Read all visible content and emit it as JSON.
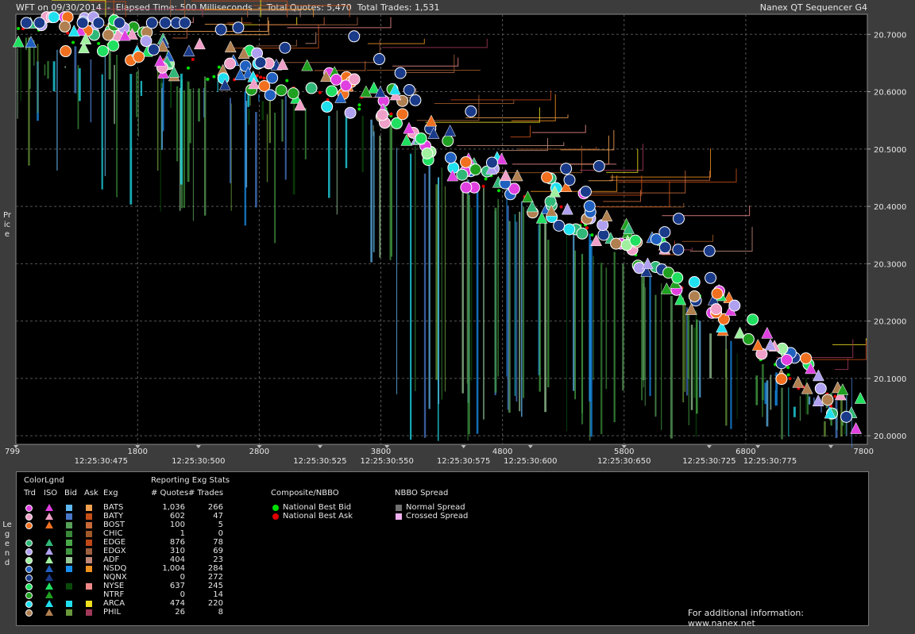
{
  "header": {
    "left": "WFT on 09/30/2014  -  Elapsed Time: 500 Milliseconds  -  Total Quotes: 5,470  Total Trades: 1,531",
    "right": "Nanex QT Sequencer G4"
  },
  "side_labels": {
    "price": "Price",
    "legend": "Legend"
  },
  "chart_data": {
    "type": "scatter",
    "x_ticks": [
      "799",
      "1800",
      "2800",
      "3800",
      "4800",
      "5800",
      "6800",
      "7800"
    ],
    "x_ticks_secondary": [
      "12:25:30:475",
      "12:25:30:500",
      "12:25:30:525",
      "12:25:30:550",
      "12:25:30:575",
      "12:25:30:600",
      "12:25:30:650",
      "12:25:30:725",
      "12:25:30:775"
    ],
    "y_ticks": [
      "20.7000",
      "20.6000",
      "20.5000",
      "20.4000",
      "20.3000",
      "20.2000",
      "20.1000",
      "20.0000"
    ],
    "xlim": [
      799,
      7800
    ],
    "ylim": [
      19.985,
      20.735
    ],
    "grid": true,
    "price_trend": [
      [
        799,
        20.71
      ],
      [
        1500,
        20.69
      ],
      [
        2300,
        20.64
      ],
      [
        3000,
        20.61
      ],
      [
        3800,
        20.57
      ],
      [
        4500,
        20.46
      ],
      [
        5300,
        20.39
      ],
      [
        6000,
        20.31
      ],
      [
        6600,
        20.2
      ],
      [
        7200,
        20.1
      ],
      [
        7800,
        20.02
      ]
    ]
  },
  "legend": {
    "color_legend_title": "ColorLgnd",
    "col_headers": [
      "Trd",
      "ISO",
      "Bid",
      "Ask",
      "Exg"
    ],
    "stats_title": "Reporting Exg Stats",
    "stats_headers": [
      "# Quotes",
      "# Trades"
    ],
    "exchanges": [
      {
        "name": "BATS",
        "quotes": "1,036",
        "trades": "266",
        "trd": "#e040e0",
        "iso": "#e040e0",
        "bid": "#60b8f0",
        "ask": "#f0a050"
      },
      {
        "name": "BATY",
        "quotes": "602",
        "trades": "47",
        "trd": "#f0a0c8",
        "iso": "#f0a0c8",
        "bid": "#4878c8",
        "ask": "#c85018"
      },
      {
        "name": "BOST",
        "quotes": "100",
        "trades": "5",
        "trd": "#f07020",
        "iso": "#f07020",
        "bid": "#58a058",
        "ask": "#c86838"
      },
      {
        "name": "CHIC",
        "quotes": "1",
        "trades": "0",
        "trd": "",
        "iso": "",
        "bid": "#388838",
        "ask": "#a05828"
      },
      {
        "name": "EDGE",
        "quotes": "876",
        "trades": "78",
        "trd": "#30b878",
        "iso": "#30b878",
        "bid": "#48a848",
        "ask": "#c04818"
      },
      {
        "name": "EDGX",
        "quotes": "310",
        "trades": "69",
        "trd": "#b0a0f0",
        "iso": "#b0a0f0",
        "bid": "#409840",
        "ask": "#a06040"
      },
      {
        "name": "ADF",
        "quotes": "404",
        "trades": "23",
        "trd": "#a0f0a0",
        "iso": "#a0f0a0",
        "bid": "#98c898",
        "ask": "#c08878"
      },
      {
        "name": "NSDQ",
        "quotes": "1,004",
        "trades": "284",
        "trd": "#2060c0",
        "iso": "#2060c0",
        "bid": "#1890f0",
        "ask": "#f09020"
      },
      {
        "name": "NQNX",
        "quotes": "0",
        "trades": "272",
        "trd": "#1a3a8a",
        "iso": "#1a3a8a",
        "bid": "",
        "ask": ""
      },
      {
        "name": "NYSE",
        "quotes": "637",
        "trades": "245",
        "trd": "#20e060",
        "iso": "#20e060",
        "bid": "#0a4a0a",
        "ask": "#f08888"
      },
      {
        "name": "NTRF",
        "quotes": "0",
        "trades": "14",
        "trd": "#20a020",
        "iso": "#20a020",
        "bid": "",
        "ask": ""
      },
      {
        "name": "ARCA",
        "quotes": "474",
        "trades": "220",
        "trd": "#20e0f0",
        "iso": "#20e0f0",
        "bid": "#20e0f0",
        "ask": "#f0e020"
      },
      {
        "name": "PHIL",
        "quotes": "26",
        "trades": "8",
        "trd": "#b08050",
        "iso": "#b08050",
        "bid": "#689838",
        "ask": "#a03858"
      }
    ],
    "composite_title": "Composite/NBBO",
    "composite_items": [
      {
        "label": "National Best Bid",
        "color": "#00e000"
      },
      {
        "label": "National Best Ask",
        "color": "#e00000"
      }
    ],
    "spread_title": "NBBO Spread",
    "spread_items": [
      {
        "label": "Normal Spread",
        "color": "#707070"
      },
      {
        "label": "Crossed Spread",
        "color": "#f0b0f0"
      }
    ],
    "footer": "For additional information: www.nanex.net"
  }
}
